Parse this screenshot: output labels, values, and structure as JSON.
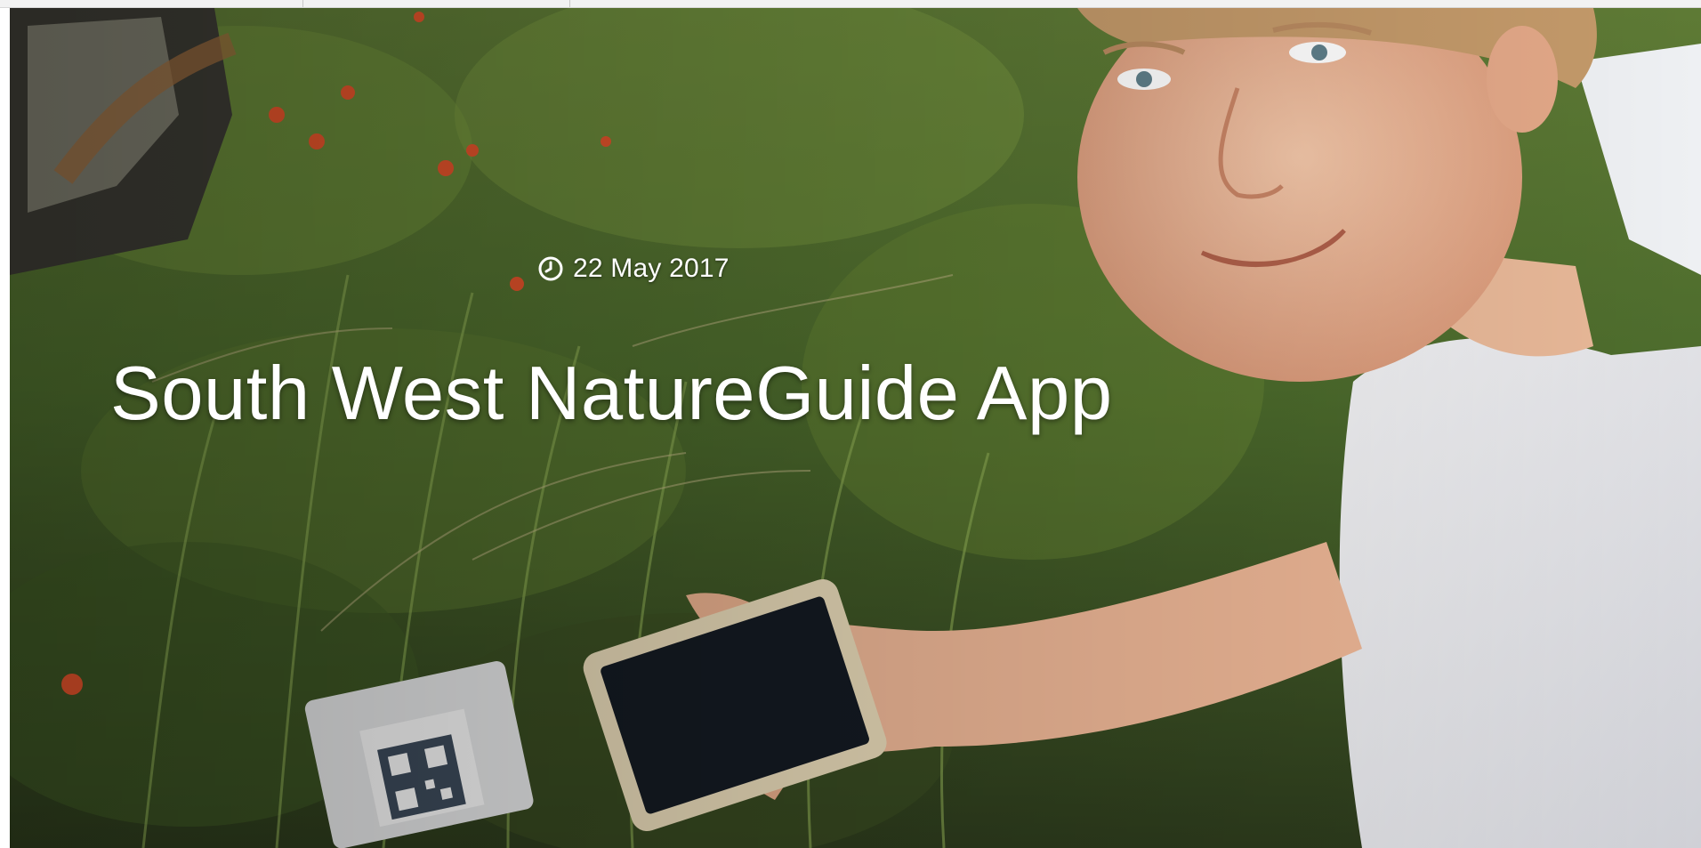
{
  "hero": {
    "date": "22 May 2017",
    "title": "South West NatureGuide App",
    "date_icon": "clock-icon",
    "photo": "boy-holding-phone-near-qr-sign-in-grass-photo"
  },
  "colors": {
    "text": "#ffffff",
    "page_background": "#ffffff",
    "grass_dark": "#2f3d1f",
    "grass_light": "#6f8f3a",
    "flower": "#e0522a"
  }
}
